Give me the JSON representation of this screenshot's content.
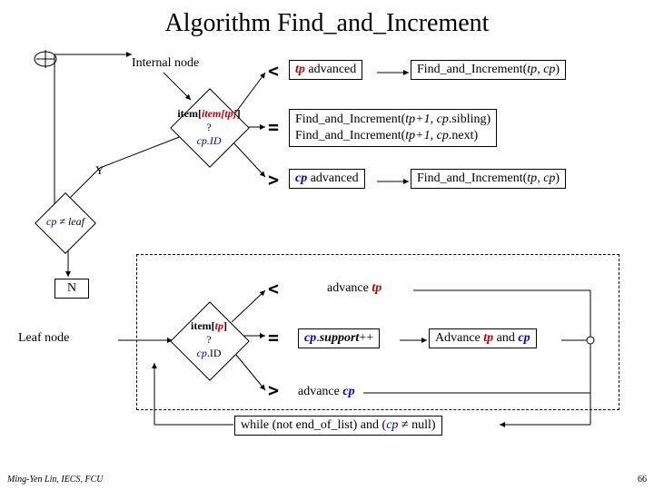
{
  "title": "Algorithm Find_and_Increment",
  "internal_node_label": "Internal node",
  "leaf_node_label": "Leaf node",
  "decision_item_line1": "item[tp]",
  "decision_item_line2": "?",
  "decision_item_line3": "cp.ID",
  "decision_leaf": "cp ≠ leaf",
  "branch_Y": "Y",
  "branch_N": "N",
  "op_lt": "<",
  "op_eq": "=",
  "op_gt": ">",
  "top_lt_text": "tp advanced",
  "top_lt_call": "Find_and_Increment(tp, cp)",
  "top_eq_line1": "Find_and_Increment(tp+1, cp.sibling)",
  "top_eq_line2": "Find_and_Increment(tp+1, cp.next)",
  "top_gt_text": "cp advanced",
  "top_gt_call": "Find_and_Increment(tp, cp)",
  "bot_lt_text": "advance tp",
  "bot_eq_box1": "cp.support++",
  "bot_eq_box2_a": "Advance ",
  "bot_eq_box2_b": "tp",
  "bot_eq_box2_c": " and ",
  "bot_eq_box2_d": "cp",
  "bot_gt_text": "advance cp",
  "while_text_a": "while (not end_of_list) and (",
  "while_text_b": "cp",
  "while_text_c": " ≠ null)",
  "footer": "Ming-Yen Lin, IECS, FCU",
  "slidenum": "66"
}
